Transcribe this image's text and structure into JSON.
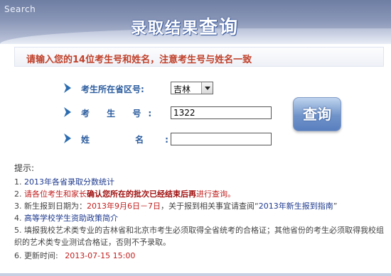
{
  "window": {
    "title": "Search"
  },
  "header": {
    "title_part1": "录取结果",
    "title_part2": "查询"
  },
  "banner": {
    "text": "请输入您的14位考生号和姓名，注意考生号与姓名一致"
  },
  "form": {
    "province_label": "考生所在省区号:",
    "province_value": "吉林",
    "exam_no_label": "考 生 号:",
    "exam_no_value": "1322",
    "name_label": "姓 名:",
    "name_value": "",
    "query_button": "查询"
  },
  "notes": {
    "title": "提示:",
    "items": [
      {
        "num": "1.",
        "text": "2013年各省录取分数统计"
      },
      {
        "num": "2.",
        "text_red": "请各位考生和家长",
        "text_bold": "确认您所在的批次已经结束后再",
        "text_red2": "进行查询。"
      },
      {
        "num": "3.",
        "text_a": "新生报到日期为：",
        "text_date": "2013年9月6日－7日",
        "text_b": "，关于报到相关事宜请查阅“",
        "text_link": "2013年新生报到指南",
        "text_c": "”"
      },
      {
        "num": "4.",
        "text": "高等学校学生资助政策简介"
      },
      {
        "num": "5.",
        "text": "填报我校艺术类专业的吉林省和北京市考生必须取得全省统考的合格证；其他省份的考生必须取得我校组织的艺术类专业测试合格证，否则不予录取。"
      },
      {
        "num": "6.",
        "label": "更新时间:",
        "time": "2013-07-15 15:00"
      }
    ]
  },
  "colors": {
    "accent": "#2b5c9e",
    "warning": "#c0402a"
  }
}
